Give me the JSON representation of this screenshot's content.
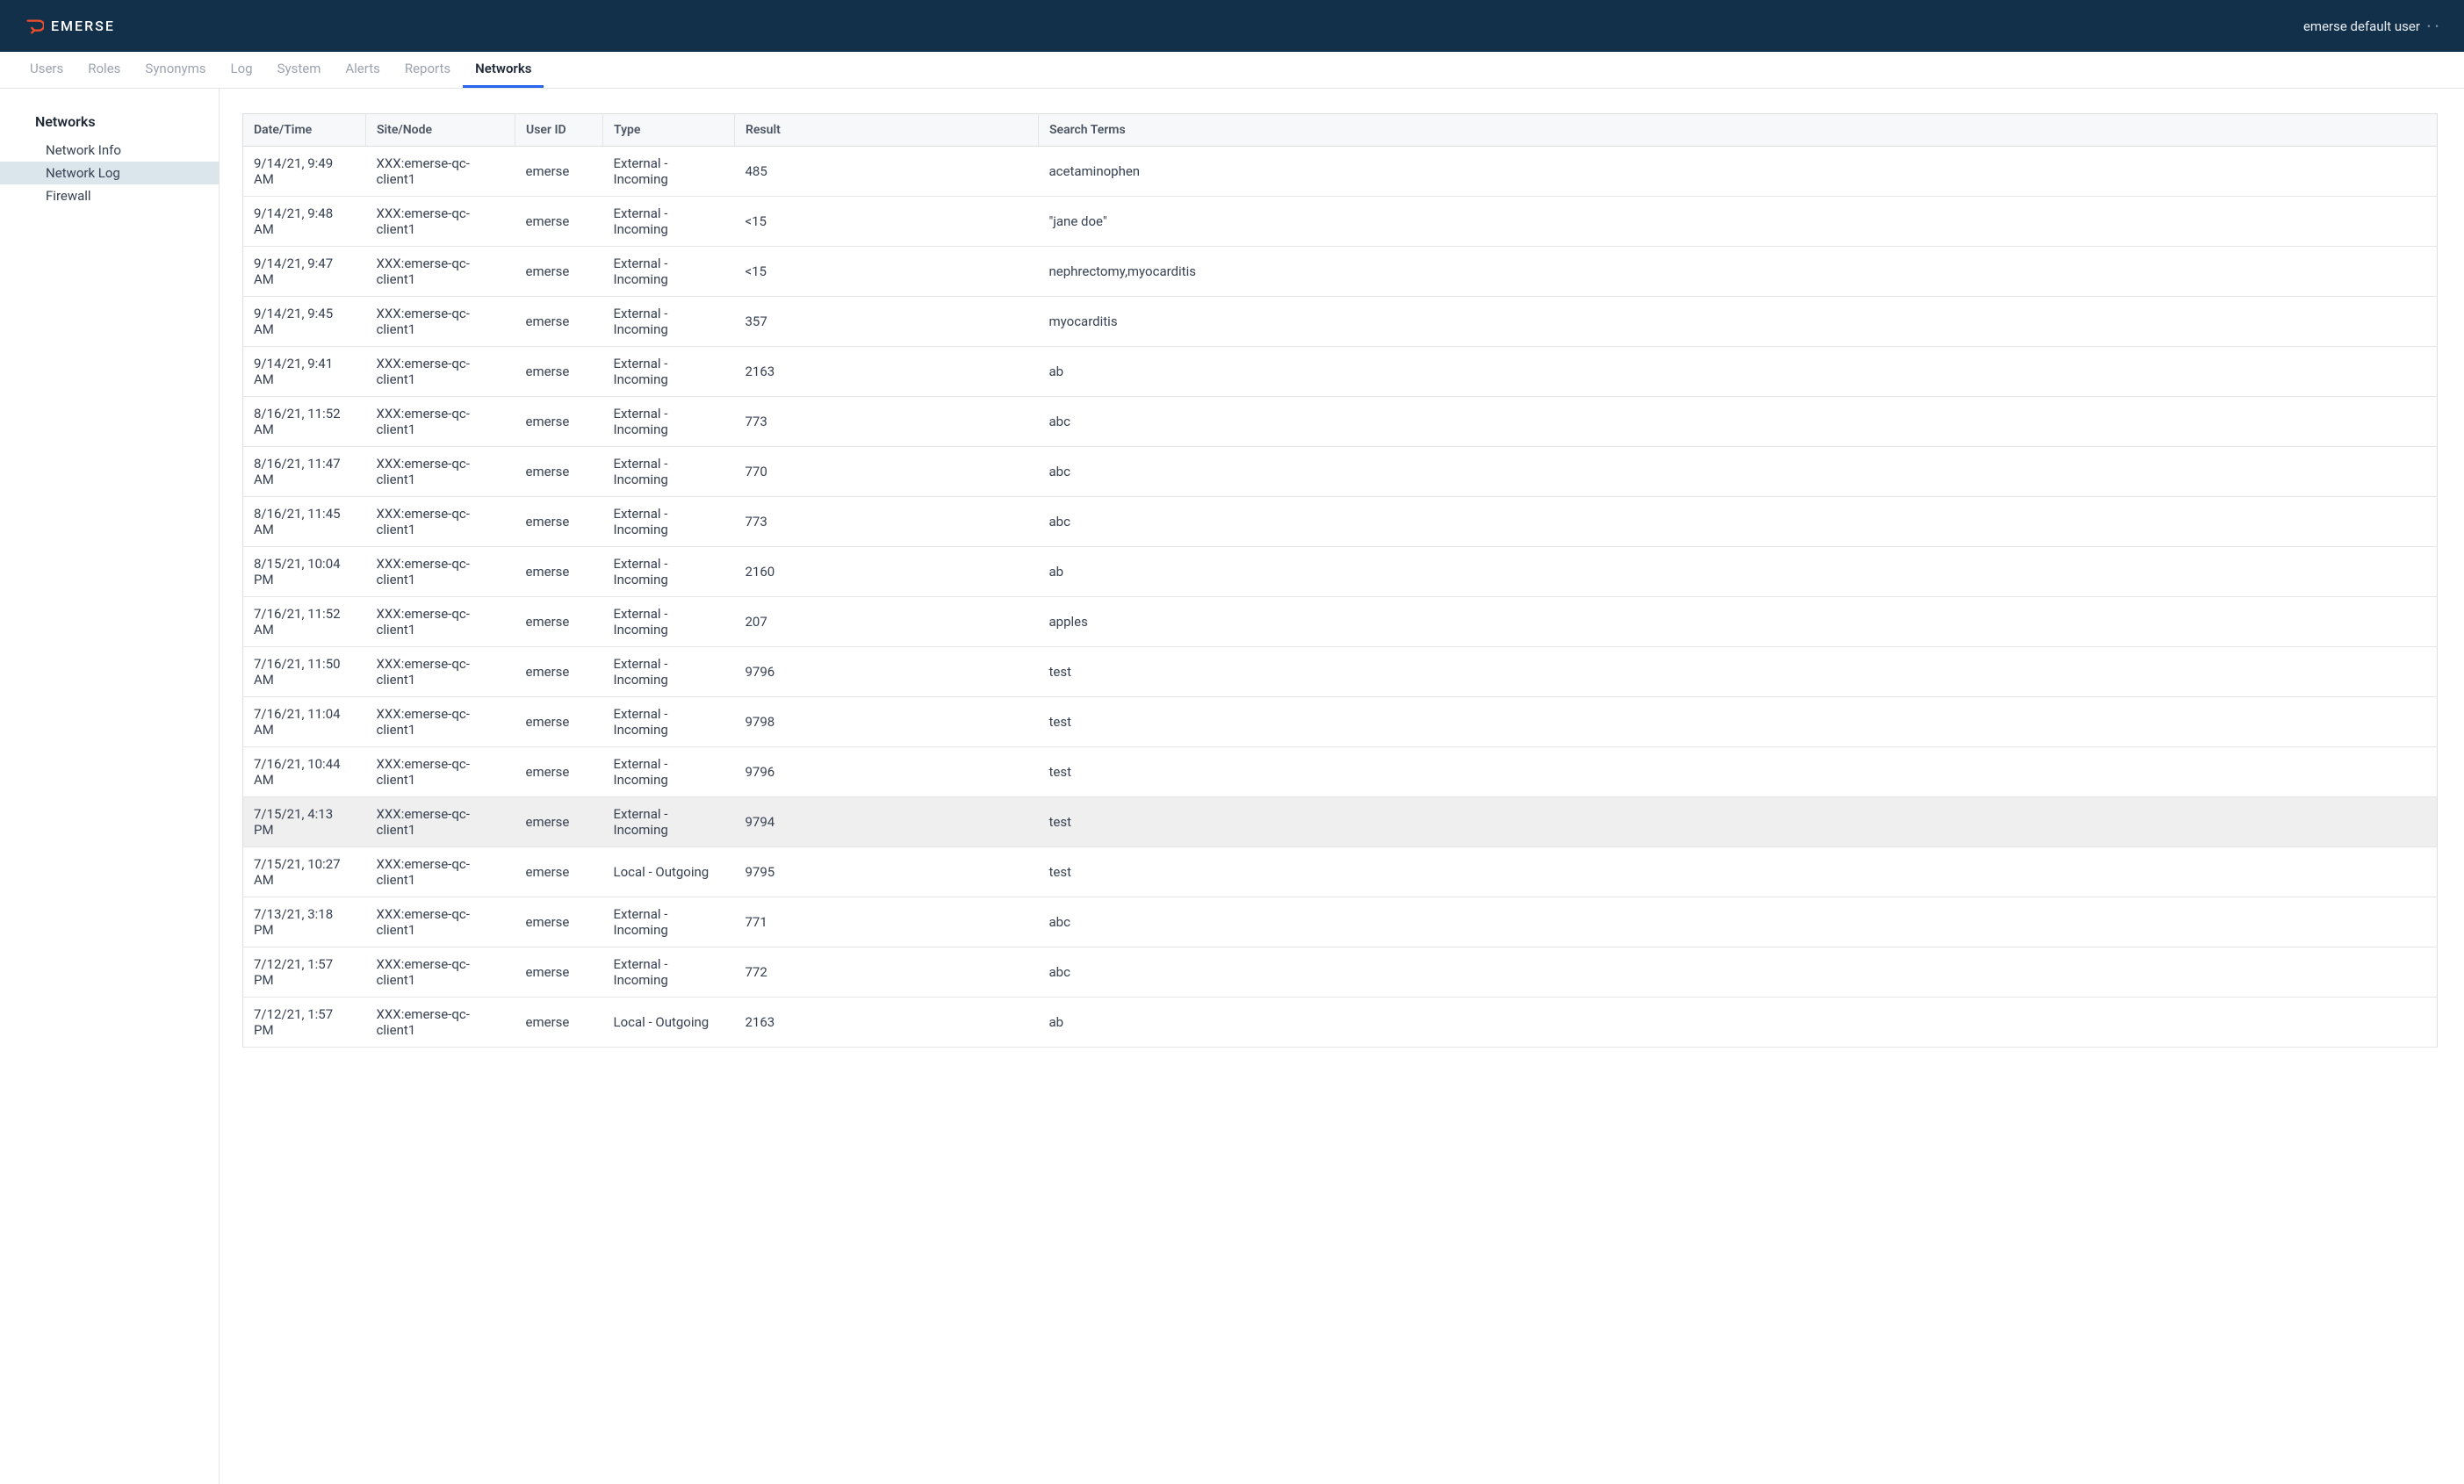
{
  "header": {
    "brand": "EMERSE",
    "username": "emerse default user"
  },
  "nav": {
    "items": [
      {
        "label": "Users",
        "active": false
      },
      {
        "label": "Roles",
        "active": false
      },
      {
        "label": "Synonyms",
        "active": false
      },
      {
        "label": "Log",
        "active": false
      },
      {
        "label": "System",
        "active": false
      },
      {
        "label": "Alerts",
        "active": false
      },
      {
        "label": "Reports",
        "active": false
      },
      {
        "label": "Networks",
        "active": true
      }
    ]
  },
  "sidebar": {
    "heading": "Networks",
    "items": [
      {
        "label": "Network Info",
        "active": false
      },
      {
        "label": "Network Log",
        "active": true
      },
      {
        "label": "Firewall",
        "active": false
      }
    ]
  },
  "table": {
    "headers": {
      "datetime": "Date/Time",
      "site": "Site/Node",
      "user": "User ID",
      "type": "Type",
      "result": "Result",
      "terms": "Search Terms"
    },
    "rows": [
      {
        "datetime": "9/14/21, 9:49 AM",
        "site": "XXX:emerse-qc-client1",
        "user": "emerse",
        "type": "External - Incoming",
        "result": "485",
        "terms": "acetaminophen",
        "highlighted": false
      },
      {
        "datetime": "9/14/21, 9:48 AM",
        "site": "XXX:emerse-qc-client1",
        "user": "emerse",
        "type": "External - Incoming",
        "result": "<15",
        "terms": "\"jane doe\"",
        "highlighted": false
      },
      {
        "datetime": "9/14/21, 9:47 AM",
        "site": "XXX:emerse-qc-client1",
        "user": "emerse",
        "type": "External - Incoming",
        "result": "<15",
        "terms": "nephrectomy,myocarditis",
        "highlighted": false
      },
      {
        "datetime": "9/14/21, 9:45 AM",
        "site": "XXX:emerse-qc-client1",
        "user": "emerse",
        "type": "External - Incoming",
        "result": "357",
        "terms": "myocarditis",
        "highlighted": false
      },
      {
        "datetime": "9/14/21, 9:41 AM",
        "site": "XXX:emerse-qc-client1",
        "user": "emerse",
        "type": "External - Incoming",
        "result": "2163",
        "terms": "ab",
        "highlighted": false
      },
      {
        "datetime": "8/16/21, 11:52 AM",
        "site": "XXX:emerse-qc-client1",
        "user": "emerse",
        "type": "External - Incoming",
        "result": "773",
        "terms": "abc",
        "highlighted": false
      },
      {
        "datetime": "8/16/21, 11:47 AM",
        "site": "XXX:emerse-qc-client1",
        "user": "emerse",
        "type": "External - Incoming",
        "result": "770",
        "terms": "abc",
        "highlighted": false
      },
      {
        "datetime": "8/16/21, 11:45 AM",
        "site": "XXX:emerse-qc-client1",
        "user": "emerse",
        "type": "External - Incoming",
        "result": "773",
        "terms": "abc",
        "highlighted": false
      },
      {
        "datetime": "8/15/21, 10:04 PM",
        "site": "XXX:emerse-qc-client1",
        "user": "emerse",
        "type": "External - Incoming",
        "result": "2160",
        "terms": "ab",
        "highlighted": false
      },
      {
        "datetime": "7/16/21, 11:52 AM",
        "site": "XXX:emerse-qc-client1",
        "user": "emerse",
        "type": "External - Incoming",
        "result": "207",
        "terms": "apples",
        "highlighted": false
      },
      {
        "datetime": "7/16/21, 11:50 AM",
        "site": "XXX:emerse-qc-client1",
        "user": "emerse",
        "type": "External - Incoming",
        "result": "9796",
        "terms": "test",
        "highlighted": false
      },
      {
        "datetime": "7/16/21, 11:04 AM",
        "site": "XXX:emerse-qc-client1",
        "user": "emerse",
        "type": "External - Incoming",
        "result": "9798",
        "terms": "test",
        "highlighted": false
      },
      {
        "datetime": "7/16/21, 10:44 AM",
        "site": "XXX:emerse-qc-client1",
        "user": "emerse",
        "type": "External - Incoming",
        "result": "9796",
        "terms": "test",
        "highlighted": false
      },
      {
        "datetime": "7/15/21, 4:13 PM",
        "site": "XXX:emerse-qc-client1",
        "user": "emerse",
        "type": "External - Incoming",
        "result": "9794",
        "terms": "test",
        "highlighted": true
      },
      {
        "datetime": "7/15/21, 10:27 AM",
        "site": "XXX:emerse-qc-client1",
        "user": "emerse",
        "type": "Local - Outgoing",
        "result": "9795",
        "terms": "test",
        "highlighted": false
      },
      {
        "datetime": "7/13/21, 3:18 PM",
        "site": "XXX:emerse-qc-client1",
        "user": "emerse",
        "type": "External - Incoming",
        "result": "771",
        "terms": "abc",
        "highlighted": false
      },
      {
        "datetime": "7/12/21, 1:57 PM",
        "site": "XXX:emerse-qc-client1",
        "user": "emerse",
        "type": "External - Incoming",
        "result": "772",
        "terms": "abc",
        "highlighted": false
      },
      {
        "datetime": "7/12/21, 1:57 PM",
        "site": "XXX:emerse-qc-client1",
        "user": "emerse",
        "type": "Local - Outgoing",
        "result": "2163",
        "terms": "ab",
        "highlighted": false
      }
    ]
  }
}
